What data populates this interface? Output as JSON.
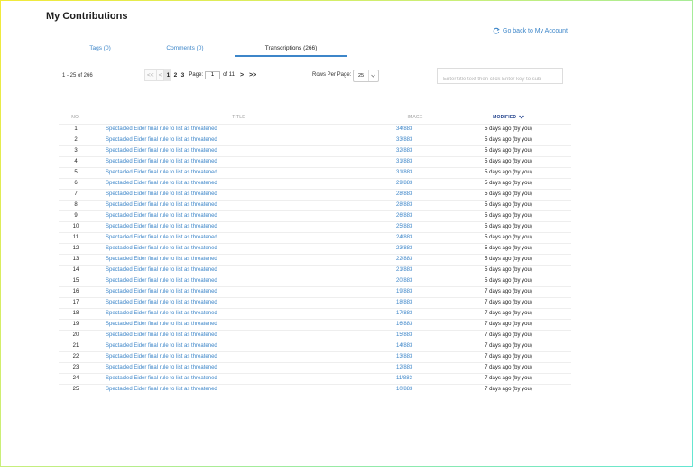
{
  "page": {
    "title": "My Contributions",
    "back_link": "Go back to My Account"
  },
  "tabs": [
    {
      "label": "Tags (0)"
    },
    {
      "label": "Comments (0)"
    },
    {
      "label": "Transcriptions (266)"
    }
  ],
  "range_info": "1 - 25 of 266",
  "pager": {
    "first": "<<",
    "prev": "<",
    "pages": [
      "1",
      "2",
      "3"
    ],
    "page_label": "Page:",
    "page_value": "1",
    "of_label": "of 11",
    "next": ">",
    "last": ">>"
  },
  "rows_per_page": {
    "label": "Rows Per Page:",
    "value": "25"
  },
  "search": {
    "placeholder": "Enter title text then click Enter key to sub"
  },
  "table": {
    "headers": {
      "no": "NO.",
      "title": "TITLE",
      "image": "IMAGE",
      "modified": "MODIFIED"
    },
    "rows": [
      {
        "no": "1",
        "title": "Spectacled Eider final rule to list as threatened",
        "image": "34/883",
        "modified": "5 days ago (by you)"
      },
      {
        "no": "2",
        "title": "Spectacled Eider final rule to list as threatened",
        "image": "33/883",
        "modified": "5 days ago (by you)"
      },
      {
        "no": "3",
        "title": "Spectacled Eider final rule to list as threatened",
        "image": "32/883",
        "modified": "5 days ago (by you)"
      },
      {
        "no": "4",
        "title": "Spectacled Eider final rule to list as threatened",
        "image": "31/883",
        "modified": "5 days ago (by you)"
      },
      {
        "no": "5",
        "title": "Spectacled Eider final rule to list as threatened",
        "image": "31/883",
        "modified": "5 days ago (by you)"
      },
      {
        "no": "6",
        "title": "Spectacled Eider final rule to list as threatened",
        "image": "29/883",
        "modified": "5 days ago (by you)"
      },
      {
        "no": "7",
        "title": "Spectacled Eider final rule to list as threatened",
        "image": "28/883",
        "modified": "5 days ago (by you)"
      },
      {
        "no": "8",
        "title": "Spectacled Eider final rule to list as threatened",
        "image": "28/883",
        "modified": "5 days ago (by you)"
      },
      {
        "no": "9",
        "title": "Spectacled Eider final rule to list as threatened",
        "image": "26/883",
        "modified": "5 days ago (by you)"
      },
      {
        "no": "10",
        "title": "Spectacled Eider final rule to list as threatened",
        "image": "25/883",
        "modified": "5 days ago (by you)"
      },
      {
        "no": "11",
        "title": "Spectacled Eider final rule to list as threatened",
        "image": "24/883",
        "modified": "5 days ago (by you)"
      },
      {
        "no": "12",
        "title": "Spectacled Eider final rule to list as threatened",
        "image": "23/883",
        "modified": "5 days ago (by you)"
      },
      {
        "no": "13",
        "title": "Spectacled Eider final rule to list as threatened",
        "image": "22/883",
        "modified": "5 days ago (by you)"
      },
      {
        "no": "14",
        "title": "Spectacled Eider final rule to list as threatened",
        "image": "21/883",
        "modified": "5 days ago (by you)"
      },
      {
        "no": "15",
        "title": "Spectacled Eider final rule to list as threatened",
        "image": "20/883",
        "modified": "5 days ago (by you)"
      },
      {
        "no": "16",
        "title": "Spectacled Eider final rule to list as threatened",
        "image": "19/883",
        "modified": "7 days ago (by you)"
      },
      {
        "no": "17",
        "title": "Spectacled Eider final rule to list as threatened",
        "image": "18/883",
        "modified": "7 days ago (by you)"
      },
      {
        "no": "18",
        "title": "Spectacled Eider final rule to list as threatened",
        "image": "17/883",
        "modified": "7 days ago (by you)"
      },
      {
        "no": "19",
        "title": "Spectacled Eider final rule to list as threatened",
        "image": "16/883",
        "modified": "7 days ago (by you)"
      },
      {
        "no": "20",
        "title": "Spectacled Eider final rule to list as threatened",
        "image": "15/883",
        "modified": "7 days ago (by you)"
      },
      {
        "no": "21",
        "title": "Spectacled Eider final rule to list as threatened",
        "image": "14/883",
        "modified": "7 days ago (by you)"
      },
      {
        "no": "22",
        "title": "Spectacled Eider final rule to list as threatened",
        "image": "13/883",
        "modified": "7 days ago (by you)"
      },
      {
        "no": "23",
        "title": "Spectacled Eider final rule to list as threatened",
        "image": "12/883",
        "modified": "7 days ago (by you)"
      },
      {
        "no": "24",
        "title": "Spectacled Eider final rule to list as threatened",
        "image": "11/883",
        "modified": "7 days ago (by you)"
      },
      {
        "no": "25",
        "title": "Spectacled Eider final rule to list as threatened",
        "image": "10/883",
        "modified": "7 days ago (by you)"
      }
    ]
  },
  "colors": {
    "link": "#3d86c9",
    "tab_underline": "#3d86c9",
    "sorted_header": "#1d3e8a"
  },
  "icons": {
    "back": "refresh-arrow-icon",
    "sort": "chevron-down-icon",
    "select": "chevron-down-icon"
  }
}
